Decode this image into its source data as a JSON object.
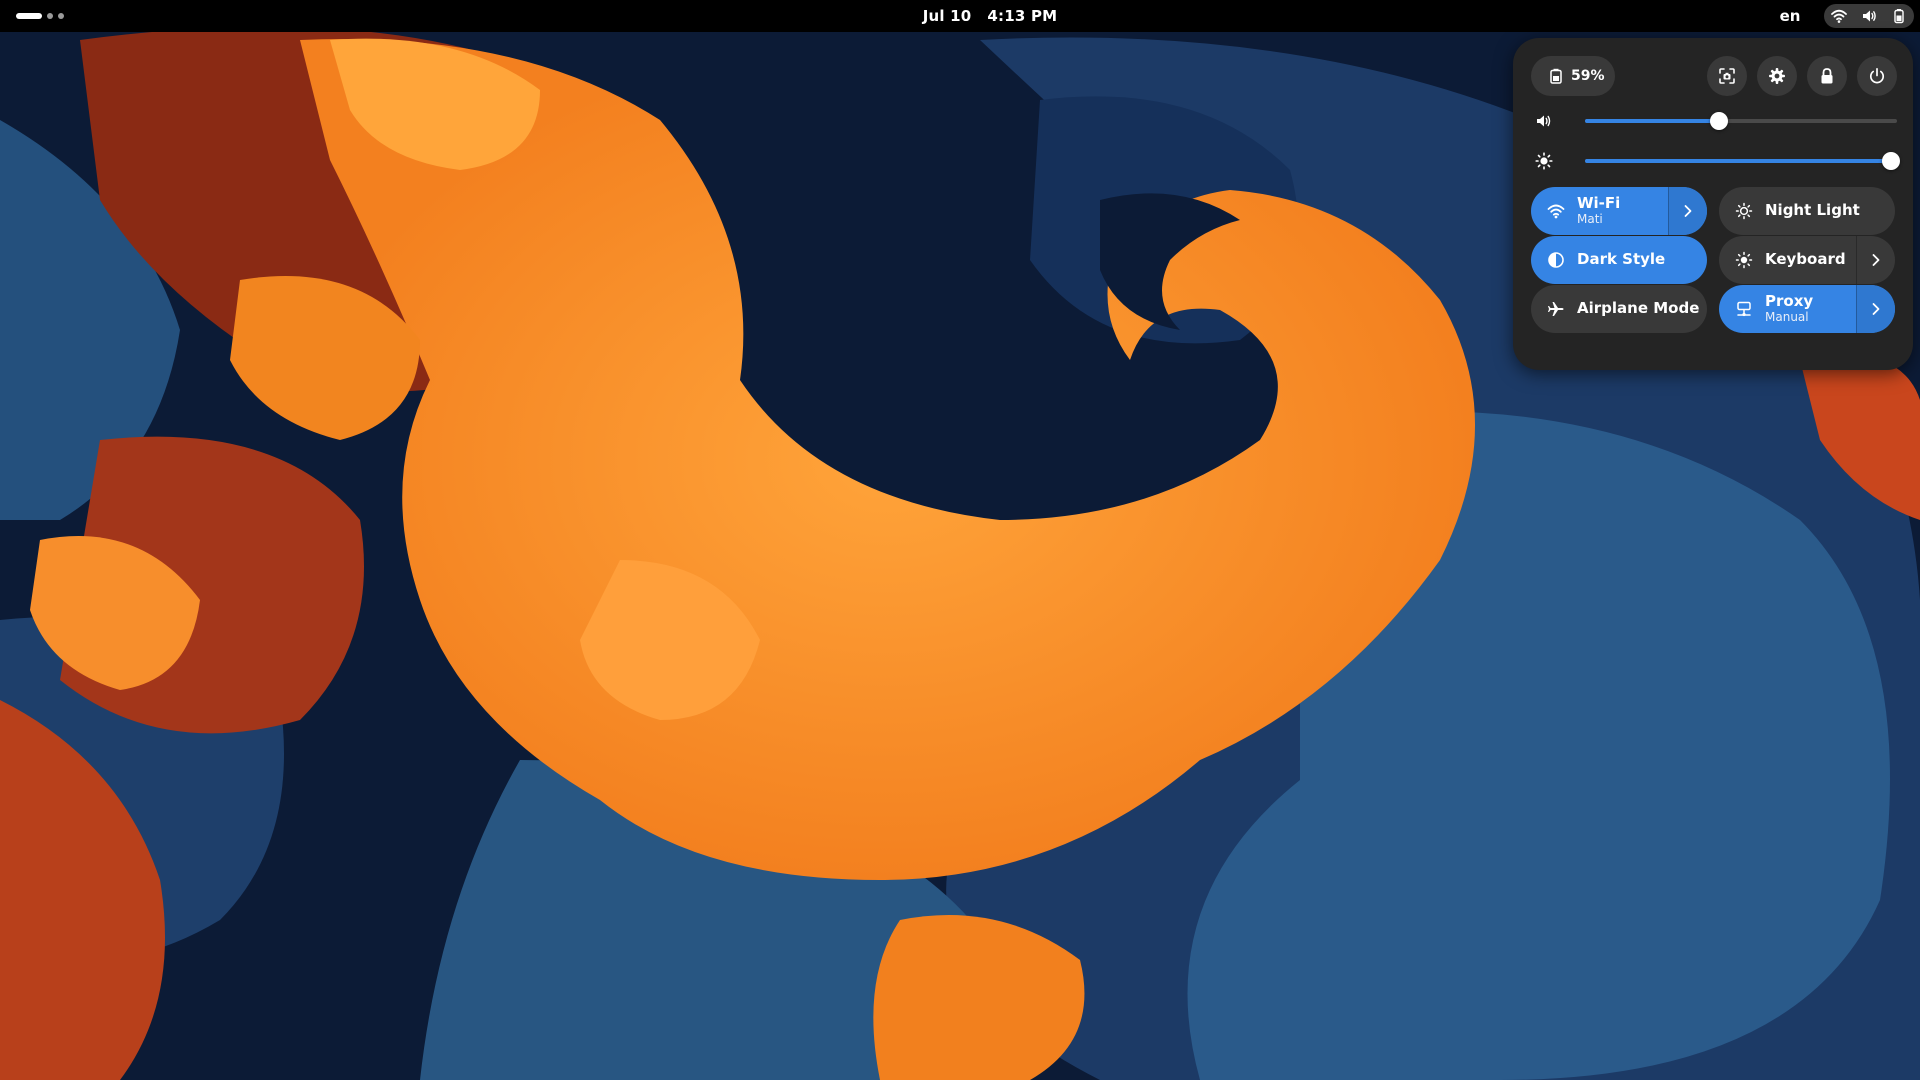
{
  "topbar": {
    "date": "Jul 10",
    "time": "4:13 PM",
    "input_language": "en",
    "icons": [
      "wifi-icon",
      "volume-icon",
      "battery-icon"
    ]
  },
  "quick_settings": {
    "battery_label": "59%",
    "actions": [
      "screenshot-icon",
      "settings-icon",
      "lock-icon",
      "power-icon"
    ],
    "volume_level": 0.43,
    "brightness_level": 0.98,
    "toggles": {
      "wifi": {
        "title": "Wi-Fi",
        "subtitle": "Mati",
        "enabled": true
      },
      "night_light": {
        "title": "Night Light",
        "enabled": false
      },
      "dark_style": {
        "title": "Dark Style",
        "enabled": true
      },
      "keyboard": {
        "title": "Keyboard",
        "enabled": false
      },
      "airplane_mode": {
        "title": "Airplane Mode",
        "enabled": false
      },
      "proxy": {
        "title": "Proxy",
        "subtitle": "Manual",
        "enabled": true
      }
    }
  },
  "colors": {
    "accent": "#3584e4",
    "panel": "#242424",
    "button": "#393939",
    "wallpaper_orange": "#f68d2a",
    "wallpaper_navy": "#0c1b36"
  }
}
